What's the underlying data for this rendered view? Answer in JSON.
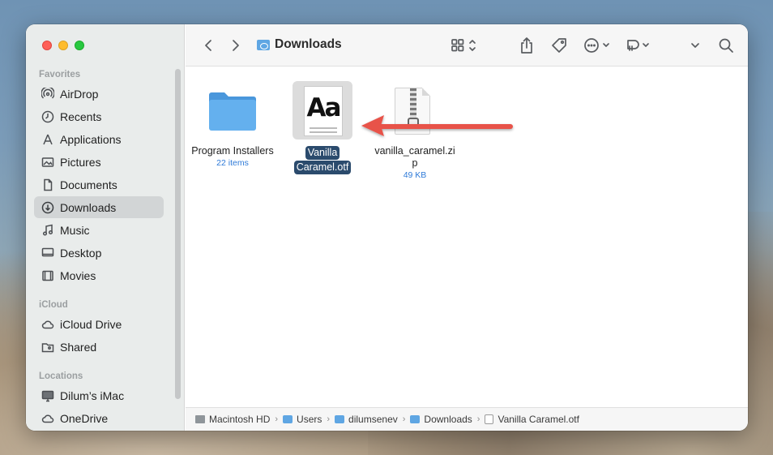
{
  "window": {
    "title": "Downloads"
  },
  "sidebar": {
    "sections": [
      {
        "title": "Favorites",
        "items": [
          {
            "label": "AirDrop",
            "icon": "airdrop-icon"
          },
          {
            "label": "Recents",
            "icon": "clock-icon"
          },
          {
            "label": "Applications",
            "icon": "applications-icon"
          },
          {
            "label": "Pictures",
            "icon": "photo-icon"
          },
          {
            "label": "Documents",
            "icon": "document-icon"
          },
          {
            "label": "Downloads",
            "icon": "download-icon",
            "active": true
          },
          {
            "label": "Music",
            "icon": "music-note-icon"
          },
          {
            "label": "Desktop",
            "icon": "desktop-icon"
          },
          {
            "label": "Movies",
            "icon": "film-icon"
          }
        ]
      },
      {
        "title": "iCloud",
        "items": [
          {
            "label": "iCloud Drive",
            "icon": "cloud-icon"
          },
          {
            "label": "Shared",
            "icon": "shared-folder-icon"
          }
        ]
      },
      {
        "title": "Locations",
        "items": [
          {
            "label": "Dilum’s iMac",
            "icon": "imac-icon"
          },
          {
            "label": "OneDrive",
            "icon": "cloud-icon"
          }
        ]
      }
    ]
  },
  "files": [
    {
      "name": "Program Installers",
      "meta": "22 items",
      "kind": "folder"
    },
    {
      "name_lines": [
        "Vanilla",
        "Caramel.otf"
      ],
      "glyph": "Aa",
      "kind": "font",
      "selected": true
    },
    {
      "name_lines": [
        "vanilla_caramel.zi",
        "p"
      ],
      "meta": "49 KB",
      "kind": "zip"
    }
  ],
  "pathbar": [
    {
      "label": "Macintosh HD",
      "icon": "hard-drive-icon"
    },
    {
      "label": "Users",
      "icon": "folder-icon"
    },
    {
      "label": "dilumsenev",
      "icon": "folder-icon"
    },
    {
      "label": "Downloads",
      "icon": "folder-icon"
    },
    {
      "label": "Vanilla Caramel.otf",
      "icon": "font-file-icon"
    }
  ],
  "colors": {
    "accent_selection": "#2b4b6d",
    "folder_blue": "#5fa6e3",
    "annotation_arrow": "#e8524a"
  }
}
